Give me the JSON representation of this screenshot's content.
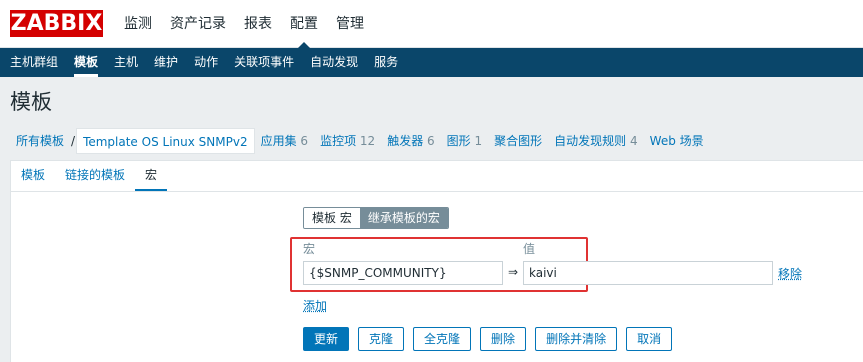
{
  "logo": "ZABBIX",
  "main_menu": [
    "监测",
    "资产记录",
    "报表",
    "配置",
    "管理"
  ],
  "main_menu_active": "配置",
  "sub_menu": [
    "主机群组",
    "模板",
    "主机",
    "维护",
    "动作",
    "关联项事件",
    "自动发现",
    "服务"
  ],
  "sub_menu_active": "模板",
  "page_title": "模板",
  "breadcrumb": {
    "all_templates": "所有模板",
    "separator": "/",
    "current": "Template OS Linux SNMPv2",
    "links": [
      {
        "label": "应用集",
        "count": "6"
      },
      {
        "label": "监控项",
        "count": "12"
      },
      {
        "label": "触发器",
        "count": "6"
      },
      {
        "label": "图形",
        "count": "1"
      },
      {
        "label": "聚合图形",
        "count": ""
      },
      {
        "label": "自动发现规则",
        "count": "4"
      },
      {
        "label": "Web 场景",
        "count": ""
      }
    ]
  },
  "tabs": [
    "模板",
    "链接的模板",
    "宏"
  ],
  "tabs_active": "宏",
  "macros": {
    "toggle": [
      "模板 宏",
      "继承模板的宏"
    ],
    "toggle_active": "模板 宏",
    "col_macro": "宏",
    "col_value": "值",
    "macro_value": "{$SNMP_COMMUNITY}",
    "arrow": "⇒",
    "value_value": "kaivi",
    "remove": "移除",
    "add": "添加"
  },
  "buttons": {
    "update": "更新",
    "clone": "克隆",
    "full_clone": "全克隆",
    "delete": "删除",
    "delete_and_clear": "删除并清除",
    "cancel": "取消"
  },
  "colors": {
    "brand": "#d40000",
    "nav": "#0a466a",
    "link": "#0275b8",
    "highlight": "#e03232"
  }
}
